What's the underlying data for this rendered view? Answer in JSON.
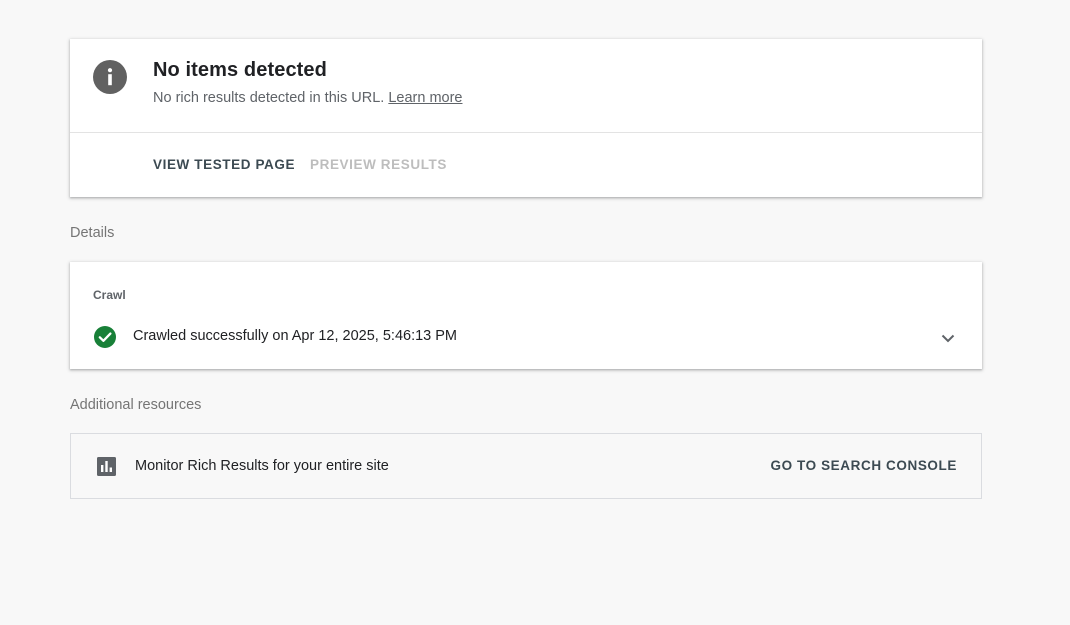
{
  "summary": {
    "icon": "info-icon",
    "title": "No items detected",
    "subtitle": "No rich results detected in this URL.",
    "learn_more": "Learn more",
    "actions": {
      "view_tested_page": "VIEW TESTED PAGE",
      "preview_results": "PREVIEW RESULTS"
    }
  },
  "details": {
    "label": "Details",
    "crawl": {
      "heading": "Crawl",
      "status_icon": "check-circle-icon",
      "status_text": "Crawled successfully on Apr 12, 2025, 5:46:13 PM",
      "expand_icon": "chevron-down-icon"
    }
  },
  "additional_resources": {
    "label": "Additional resources",
    "item": {
      "icon": "bar-chart-icon",
      "text": "Monitor Rich Results for your entire site",
      "action": "GO TO SEARCH CONSOLE"
    }
  },
  "colors": {
    "page_background": "#f8f8f8",
    "info_icon": "#616161",
    "success": "#188038",
    "action_text": "#3c4a52",
    "disabled_text": "#bdbdbd"
  }
}
